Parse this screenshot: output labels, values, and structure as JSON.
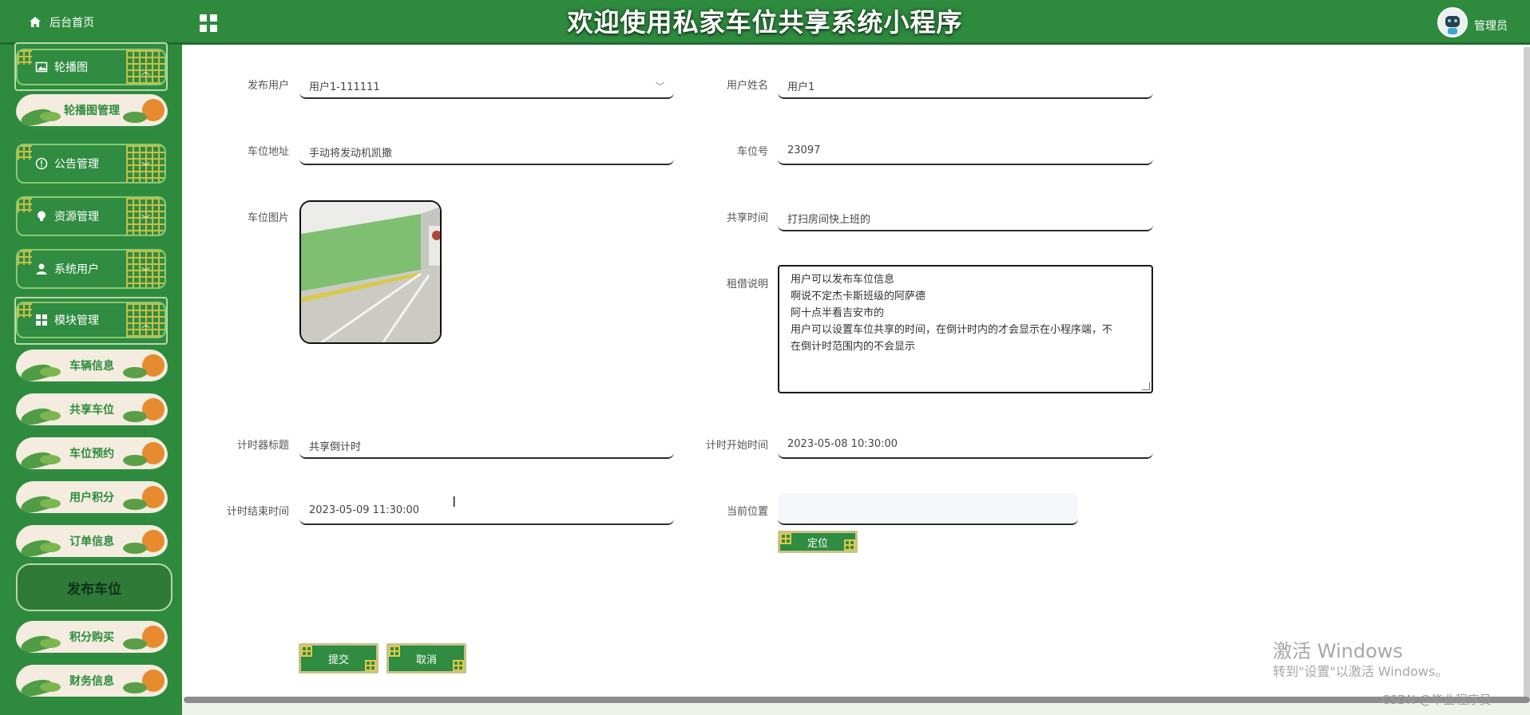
{
  "header": {
    "home_label": "后台首页",
    "title": "欢迎使用私家车位共享系统小程序",
    "username": "管理员"
  },
  "sidebar": {
    "groups": [
      {
        "label": "轮播图",
        "icon": "image-icon",
        "expanded": true
      },
      {
        "label": "公告管理",
        "icon": "info-icon",
        "expanded": false
      },
      {
        "label": "资源管理",
        "icon": "bulb-icon",
        "expanded": false
      },
      {
        "label": "系统用户",
        "icon": "user-icon",
        "expanded": false
      },
      {
        "label": "模块管理",
        "icon": "grid-icon",
        "expanded": true
      }
    ],
    "carousel_items": [
      "轮播图管理"
    ],
    "module_items": [
      "车辆信息",
      "共享车位",
      "车位预约",
      "用户积分",
      "订单信息",
      "发布车位",
      "积分购买",
      "财务信息"
    ],
    "active_item": "发布车位"
  },
  "form": {
    "publisher_user": {
      "label": "发布用户",
      "value": "用户1-111111"
    },
    "user_name": {
      "label": "用户姓名",
      "value": "用户1"
    },
    "address": {
      "label": "车位地址",
      "value": "手动将发动机凯撒"
    },
    "space_no": {
      "label": "车位号",
      "value": "23097"
    },
    "photo": {
      "label": "车位图片"
    },
    "share_time": {
      "label": "共享时间",
      "value": "打扫房间快上班的"
    },
    "rental_desc": {
      "label": "租借说明",
      "lines": [
        "用户可以发布车位信息",
        "啊说不定杰卡斯班级的阿萨德",
        "阿十点半看吉安市的",
        "用户可以设置车位共享的时间，在倒计时内的才会显示在小程序端，不",
        "在倒计时范围内的不会显示"
      ]
    },
    "timer_title": {
      "label": "计时器标题",
      "value": "共享倒计时"
    },
    "timer_start": {
      "label": "计时开始时间",
      "value": "2023-05-08 10:30:00"
    },
    "timer_end": {
      "label": "计时结束时间",
      "value": "2023-05-09 11:30:00"
    },
    "location": {
      "label": "当前位置",
      "value": ""
    },
    "locate_button": "定位",
    "submit_button": "提交",
    "cancel_button": "取消"
  },
  "watermark": {
    "line1": "激活 Windows",
    "line2": "转到\"设置\"以激活 Windows。",
    "csdn": "CSDN @毕业程序员"
  },
  "colors": {
    "primary_green": "#2e8b3e",
    "accent_gold": "#e3c84a"
  }
}
